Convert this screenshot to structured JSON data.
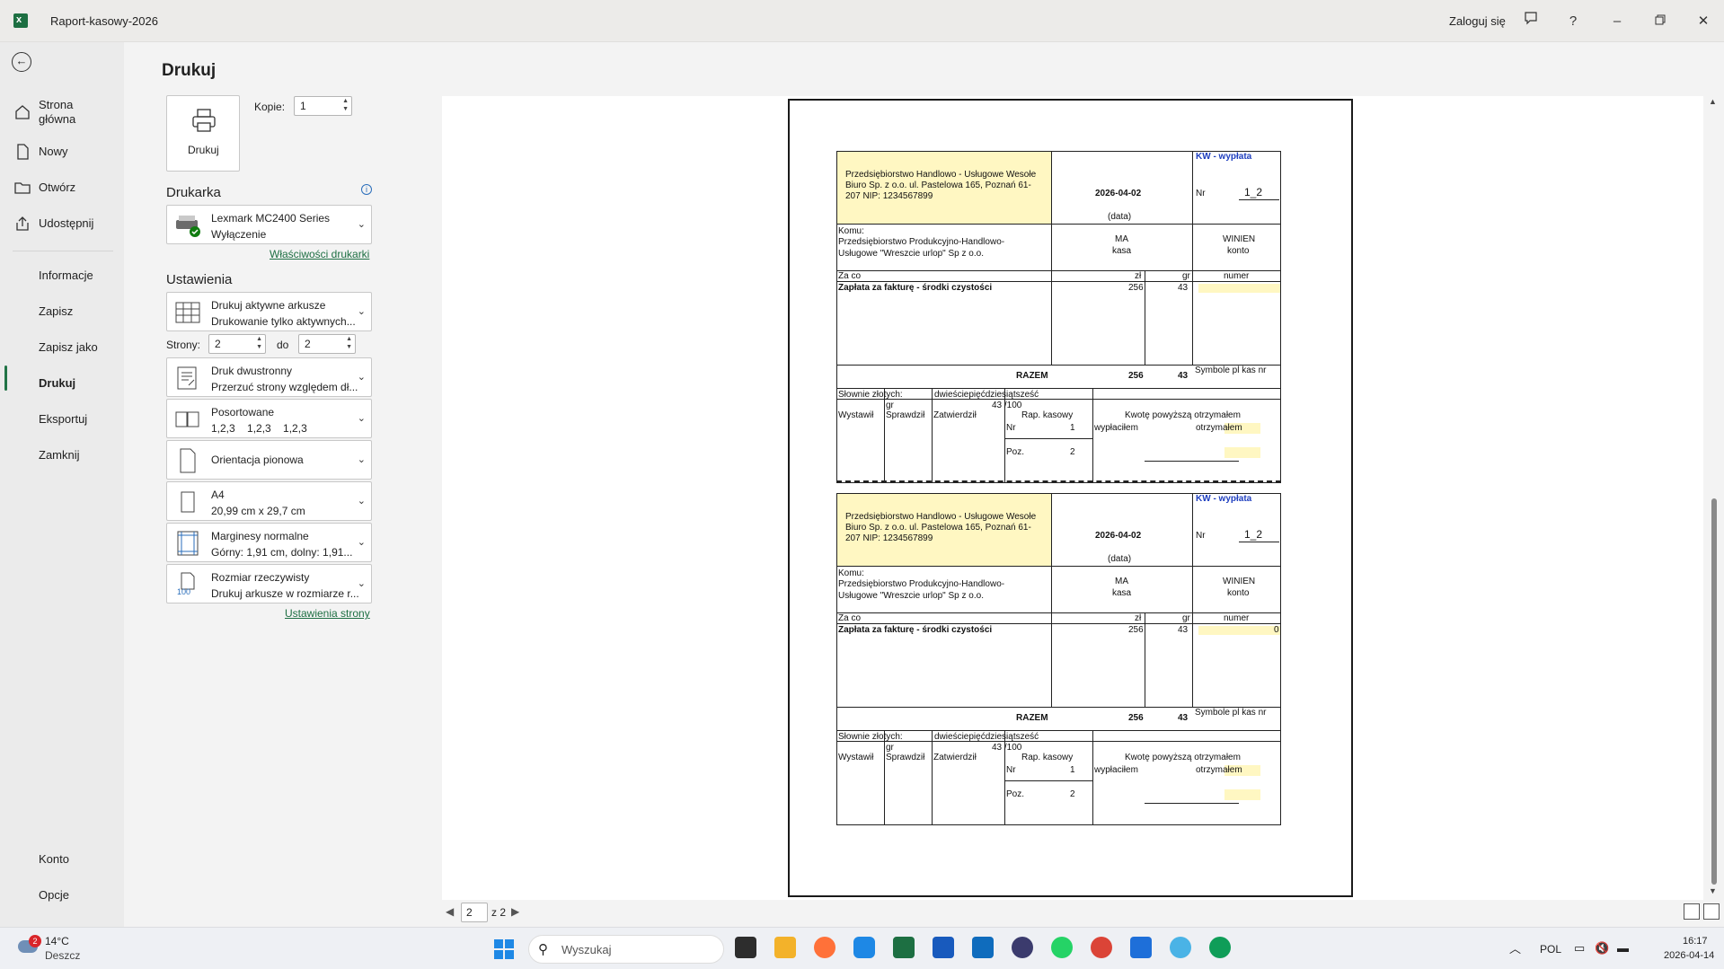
{
  "window": {
    "title": "Raport-kasowy-2026",
    "signin": "Zaloguj się",
    "help": "?"
  },
  "nav": {
    "back": "back",
    "items": [
      {
        "label": "Strona\ngłówna"
      },
      {
        "label": "Nowy"
      },
      {
        "label": "Otwórz"
      },
      {
        "label": "Udostępnij"
      },
      {
        "label": "Informacje"
      },
      {
        "label": "Zapisz"
      },
      {
        "label": "Zapisz jako"
      },
      {
        "label": "Drukuj"
      },
      {
        "label": "Eksportuj"
      },
      {
        "label": "Zamknij"
      }
    ],
    "bottom": [
      {
        "label": "Konto"
      },
      {
        "label": "Opcje"
      }
    ]
  },
  "print": {
    "title": "Drukuj",
    "print_button": "Drukuj",
    "copies_label": "Kopie:",
    "copies_value": "1",
    "printer_section": "Drukarka",
    "printer_name": "Lexmark MC2400 Series",
    "printer_status": "Wyłączenie",
    "printer_props": "Właściwości drukarki",
    "settings_section": "Ustawienia",
    "what": {
      "l1": "Drukuj aktywne arkusze",
      "l2": "Drukowanie tylko aktywnych..."
    },
    "pages_label": "Strony:",
    "pages_from": "2",
    "pages_to_label": "do",
    "pages_to": "2",
    "duplex": {
      "l1": "Druk dwustronny",
      "l2": "Przerzuć strony względem dł..."
    },
    "collate": {
      "l1": "Posortowane",
      "l2": "1,2,3    1,2,3    1,2,3"
    },
    "orientation": {
      "l1": "Orientacja pionowa"
    },
    "paper": {
      "l1": "A4",
      "l2": "20,99  cm x 29,7  cm"
    },
    "margins": {
      "l1": "Marginesy normalne",
      "l2": "Górny: 1,91  cm, dolny: 1,91..."
    },
    "scaling": {
      "l1": "Rozmiar rzeczywisty",
      "l2": "Drukuj arkusze w rozmiarze r...",
      "badge": "100"
    },
    "page_setup": "Ustawienia strony"
  },
  "preview": {
    "current_page": "2",
    "of_pages": "z 2",
    "voucher": {
      "type": "KW - wypłata",
      "company": "Przedsiębiorstwo Handlowo - Usługowe Wesołe Biuro Sp. z o.o. ul. Pastelowa 165, Poznań 61-207 NIP: 1234567899",
      "company_l1": "Przedsiębiorstwo Handlowo - Usługowe Wesołe",
      "company_l2": "Biuro Sp. z o.o. ul. Pastelowa 165, Poznań 61-",
      "company_l3": "207 NIP: 1234567899",
      "date": "2026-04-02",
      "date_label": "(data)",
      "nr_label": "Nr",
      "nr_value": "1_2",
      "komu": "Komu:",
      "recipient_l1": "Przedsiębiorstwo Produkcyjno-Handlowo-",
      "recipient_l2": "Usługowe \"Wreszcie urlop\" Sp z o.o.",
      "ma": "MA",
      "kasa": "kasa",
      "winien": "WINIEN",
      "konto": "konto",
      "za_co": "Za co",
      "zl": "zł",
      "gr": "gr",
      "numer": "numer",
      "desc": "Zapłata za fakturę - środki czystości",
      "amount_zl": "256",
      "amount_gr": "43",
      "razem": "RAZEM",
      "symbole": "Symbole pl kas nr",
      "slownie": "Słownie złotych:",
      "slownie_value": "dwieściepięćdziesiątsześć",
      "gr_label": "gr",
      "gr_value": "43 /100",
      "wystawil": "Wystawił",
      "sprawdzil": "Sprawdził",
      "zatwierdzil": "Zatwierdził",
      "rap_kasowy": "Rap. kasowy",
      "kwote": "Kwotę powyższą otrzymałem",
      "nr2": "Nr",
      "nr2_value": "1",
      "poz": "Poz.",
      "poz_value": "2",
      "wyplacilem": "wypłaciłem",
      "otrzymalem": "otrzymałem",
      "numer_value_second": "0"
    }
  },
  "taskbar": {
    "weather_temp": "14°C",
    "weather_desc": "Deszcz",
    "weather_badge": "2",
    "search_placeholder": "Wyszukaj",
    "lang": "POL",
    "time": "16:17",
    "date": "2026-04-14"
  }
}
